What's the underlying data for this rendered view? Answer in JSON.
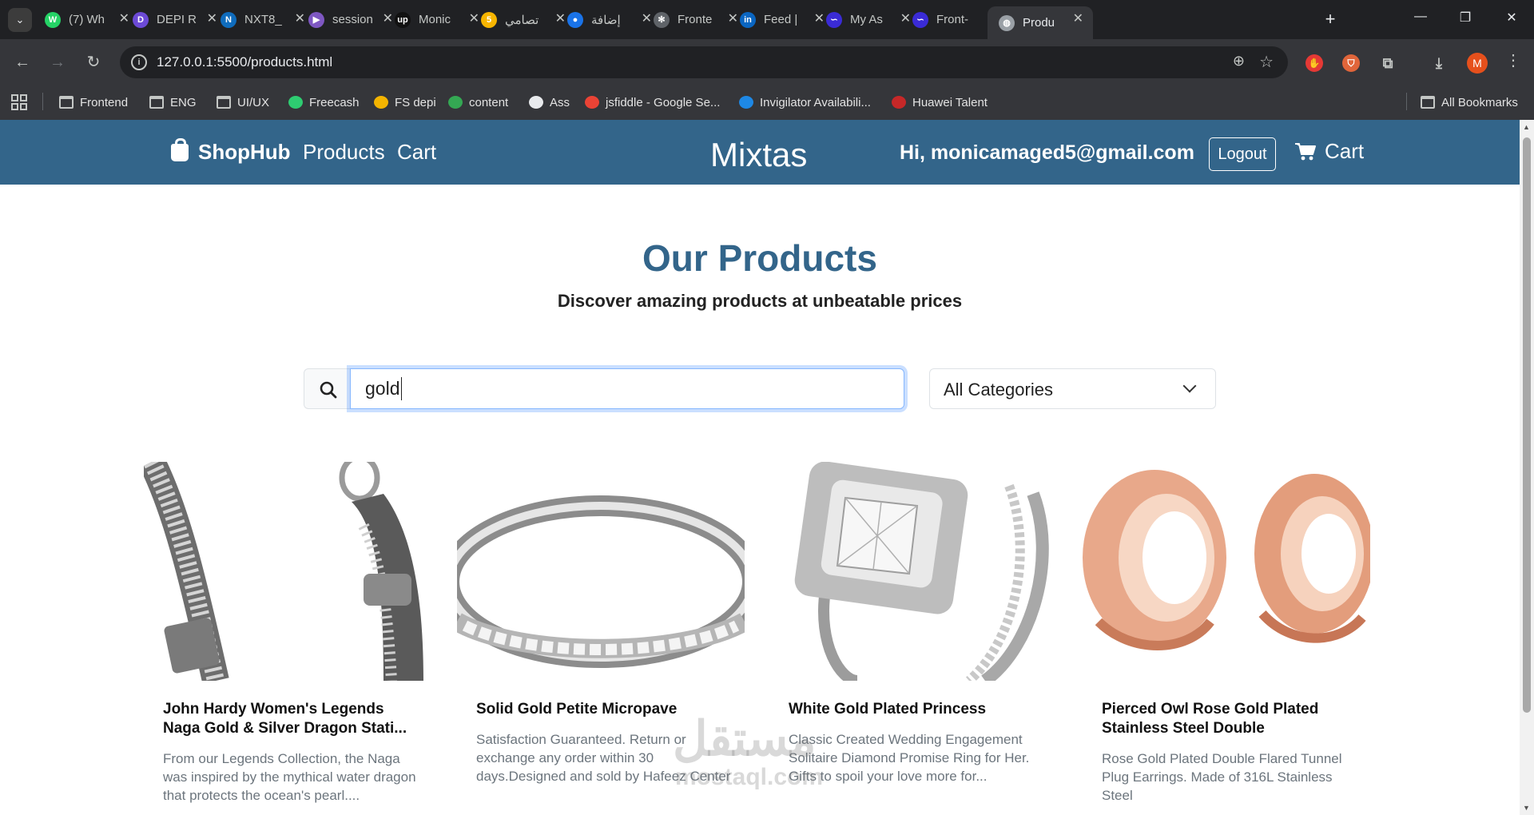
{
  "browser": {
    "tabs": [
      {
        "title": "(7) Wh",
        "icon": "whatsapp-icon",
        "color": "#25d366",
        "glyph": "W"
      },
      {
        "title": "DEPI R",
        "icon": "notes-icon",
        "color": "#6c4ad6",
        "glyph": "D"
      },
      {
        "title": "NXT8_",
        "icon": "onedrive-icon",
        "color": "#0f6cbd",
        "glyph": "N"
      },
      {
        "title": "session",
        "icon": "video-icon",
        "color": "#7e57c2",
        "glyph": "▶"
      },
      {
        "title": "Monic",
        "icon": "upwork-icon",
        "color": "#111111",
        "glyph": "up"
      },
      {
        "title": "تصامي",
        "icon": "khamsat-icon",
        "color": "#f7b500",
        "glyph": "5"
      },
      {
        "title": "إضافة",
        "icon": "circle-icon",
        "color": "#1a73e8",
        "glyph": "●"
      },
      {
        "title": "Fronte",
        "icon": "chatgpt-icon",
        "color": "#5f6368",
        "glyph": "✻"
      },
      {
        "title": "Feed |",
        "icon": "linkedin-icon",
        "color": "#0a66c2",
        "glyph": "in"
      },
      {
        "title": "My As",
        "icon": "depi-icon",
        "color": "#3a2bd6",
        "glyph": "∽"
      },
      {
        "title": "Front-",
        "icon": "depi-icon",
        "color": "#3a2bd6",
        "glyph": "∽"
      },
      {
        "title": "Produ",
        "icon": "globe-icon",
        "color": "#9aa0a6",
        "glyph": "◍",
        "active": true
      }
    ],
    "url": "127.0.0.1:5500/products.html",
    "profile_initial": "M",
    "bookmarks": [
      {
        "label": "Frontend",
        "type": "folder"
      },
      {
        "label": "ENG",
        "type": "folder"
      },
      {
        "label": "UI/UX",
        "type": "folder"
      },
      {
        "label": "Freecash",
        "type": "site",
        "color": "#2ecc71"
      },
      {
        "label": "FS depi",
        "type": "site",
        "color": "#f4b400"
      },
      {
        "label": "content",
        "type": "site",
        "color": "#34a853"
      },
      {
        "label": "Ass",
        "type": "site",
        "color": "#e8eaed"
      },
      {
        "label": "jsfiddle - Google Se...",
        "type": "site",
        "color": "#ea4335"
      },
      {
        "label": "Invigilator Availabili...",
        "type": "site",
        "color": "#1e88e5"
      },
      {
        "label": "Huawei Talent",
        "type": "site",
        "color": "#c62828"
      }
    ],
    "all_bookmarks": "All Bookmarks"
  },
  "navbar": {
    "brand": "ShopHub",
    "links": [
      "Products",
      "Cart"
    ],
    "site_name": "Mixtas",
    "greeting": "Hi, monicamaged5@gmail.com",
    "logout": "Logout",
    "cart": "Cart",
    "bg_color": "#33658a"
  },
  "hero": {
    "title": "Our Products",
    "subtitle": "Discover amazing products at unbeatable prices"
  },
  "search": {
    "value": "gold",
    "category": "All Categories"
  },
  "products": [
    {
      "title": "John Hardy Women's Legends Naga Gold & Silver Dragon Stati...",
      "description": "From our Legends Collection, the Naga was inspired by the mythical water dragon that protects the ocean's pearl....",
      "image": "dragon-bracelet"
    },
    {
      "title": "Solid Gold Petite Micropave",
      "description": "Satisfaction Guaranteed. Return or exchange any order within 30 days.Designed and sold by Hafeez Center in the United States. Satisfaction",
      "image": "micropave-ring"
    },
    {
      "title": "White Gold Plated Princess",
      "description": "Classic Created Wedding Engagement Solitaire Diamond Promise Ring for Her. Gifts to spoil your love more for... Engagement, Wedding, Anniversary,",
      "image": "princess-ring"
    },
    {
      "title": "Pierced Owl Rose Gold Plated Stainless Steel Double",
      "description": "Rose Gold Plated Double Flared Tunnel Plug Earrings. Made of 316L Stainless Steel",
      "image": "tunnel-plugs"
    }
  ],
  "watermark": {
    "arabic": "مستقل",
    "latin": "mostaql.com"
  }
}
